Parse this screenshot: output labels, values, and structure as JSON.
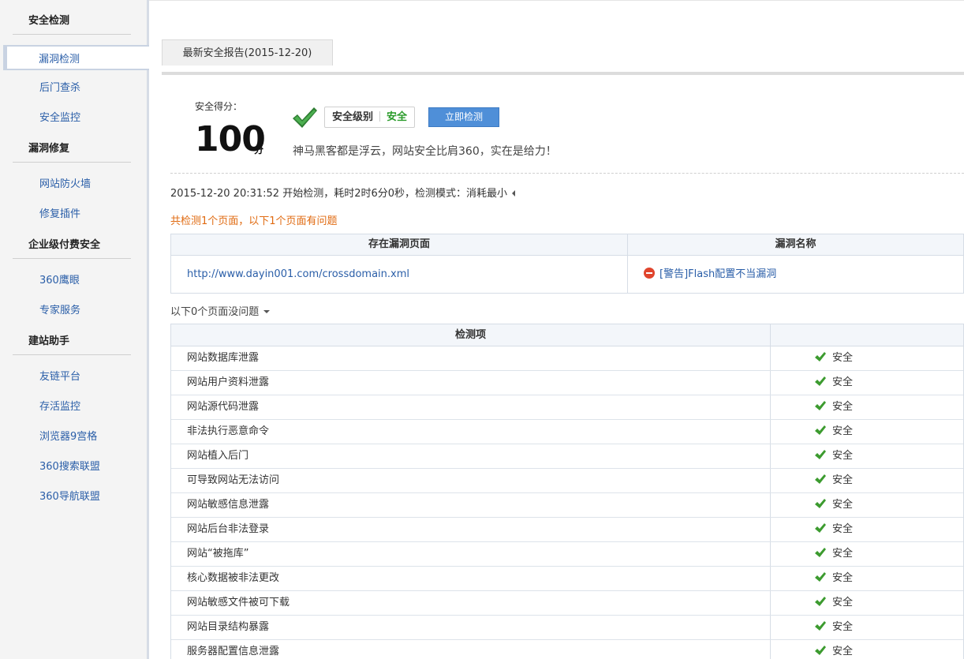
{
  "sidebar": {
    "sections": [
      {
        "title": "安全检测",
        "items": [
          "漏洞检测",
          "后门查杀",
          "安全监控"
        ]
      },
      {
        "title": "漏洞修复",
        "items": [
          "网站防火墙",
          "修复插件"
        ]
      },
      {
        "title": "企业级付费安全",
        "items": [
          "360鹰眼",
          "专家服务"
        ]
      },
      {
        "title": "建站助手",
        "items": [
          "友链平台",
          "存活监控",
          "浏览器9宫格",
          "360搜索联盟",
          "360导航联盟"
        ]
      }
    ],
    "active_item": "漏洞检测"
  },
  "report_tab": "最新安全报告(2015-12-20)",
  "score": {
    "label": "安全得分：",
    "value": "100",
    "unit": "分"
  },
  "level": {
    "label": "安全级别",
    "value": "安全"
  },
  "scan_button": "立即检测",
  "slogan": "神马黑客都是浮云，网站安全比肩360，实在是给力！",
  "scan_info": "2015-12-20 20:31:52 开始检测，耗时2时6分0秒，检测模式：消耗最小",
  "summary": "共检测1个页面，以下1个页面有问题",
  "vuln_table": {
    "headers": [
      "存在漏洞页面",
      "漏洞名称"
    ],
    "rows": [
      {
        "page": "http://www.dayin001.com/crossdomain.xml",
        "name": "[警告]Flash配置不当漏洞"
      }
    ]
  },
  "ok_summary": "以下0个页面没问题",
  "check_table": {
    "header": "检测项",
    "rows": [
      {
        "item": "网站数据库泄露",
        "status": "安全"
      },
      {
        "item": "网站用户资料泄露",
        "status": "安全"
      },
      {
        "item": "网站源代码泄露",
        "status": "安全"
      },
      {
        "item": "非法执行恶意命令",
        "status": "安全"
      },
      {
        "item": "网站植入后门",
        "status": "安全"
      },
      {
        "item": "可导致网站无法访问",
        "status": "安全"
      },
      {
        "item": "网站敏感信息泄露",
        "status": "安全"
      },
      {
        "item": "网站后台非法登录",
        "status": "安全"
      },
      {
        "item": "网站“被拖库”",
        "status": "安全"
      },
      {
        "item": "核心数据被非法更改",
        "status": "安全"
      },
      {
        "item": "网站敏感文件被可下载",
        "status": "安全"
      },
      {
        "item": "网站目录结构暴露",
        "status": "安全"
      },
      {
        "item": "服务器配置信息泄露",
        "status": "安全"
      }
    ]
  },
  "colors": {
    "link": "#2a5ea8",
    "accent_green": "#2a9b2a",
    "warning_orange": "#e06a10",
    "button_blue": "#4f8fd8"
  }
}
